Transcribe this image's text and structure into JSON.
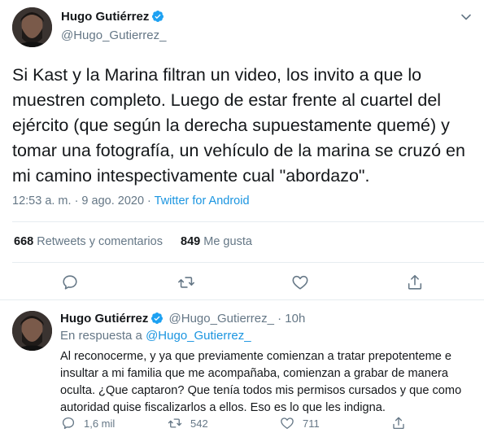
{
  "main_tweet": {
    "author_name": "Hugo Gutiérrez",
    "author_handle": "@Hugo_Gutierrez_",
    "text": "Si Kast y la Marina filtran un video, los invito a que lo muestren completo. Luego de estar frente al cuartel del ejército (que según la derecha supuestamente quemé) y tomar una fotografía, un vehículo de la marina se cruzó en mi camino intespectivamente cual \"abordazo\".",
    "timestamp": "12:53 a. m. · 9 ago. 2020 · ",
    "source": "Twitter for Android",
    "retweets_count": "668",
    "retweets_label": "Retweets y comentarios",
    "likes_count": "849",
    "likes_label": "Me gusta"
  },
  "reply_tweet": {
    "author_name": "Hugo Gutiérrez",
    "author_handle": "@Hugo_Gutierrez_ · 10h",
    "reply_prefix": "En respuesta a ",
    "reply_target": "@Hugo_Gutierrez_",
    "text": "Al reconocerme, y ya que previamente comienzan a tratar prepotenteme e insultar a mi familia que me acompañaba, comienzan a grabar de manera oculta. ¿Que captaron? Que tenía todos mis permisos cursados y que como autoridad quise fiscalizarlos a ellos. Eso es lo que les indigna.",
    "replies_count": "1,6 mil",
    "retweets_count": "542",
    "likes_count": "711"
  },
  "colors": {
    "accent": "#1b95e0",
    "verified": "#1da1f2",
    "muted": "#657786",
    "text": "#14171a"
  },
  "icons": [
    "verified-badge-icon",
    "chevron-down-icon",
    "reply-icon",
    "retweet-icon",
    "like-icon",
    "share-icon"
  ]
}
